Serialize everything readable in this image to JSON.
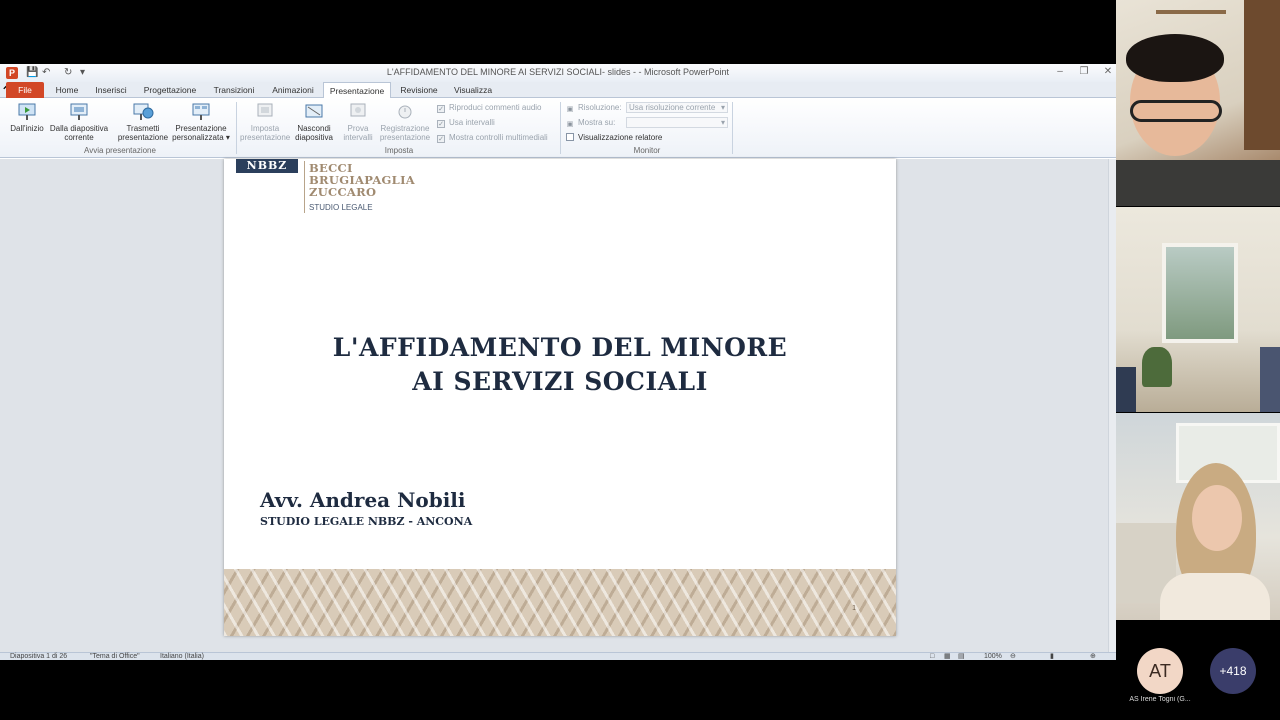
{
  "window": {
    "title": "L'AFFIDAMENTO DEL MINORE AI SERVIZI SOCIALI- slides -  -  Microsoft PowerPoint",
    "app_icon": "P"
  },
  "tabs": [
    {
      "label": "File"
    },
    {
      "label": "Home"
    },
    {
      "label": "Inserisci"
    },
    {
      "label": "Progettazione"
    },
    {
      "label": "Transizioni"
    },
    {
      "label": "Animazioni"
    },
    {
      "label": "Presentazione"
    },
    {
      "label": "Revisione"
    },
    {
      "label": "Visualizza"
    }
  ],
  "ribbon": {
    "avvia": {
      "dallinizio": "Dall'inizio",
      "dalla_l1": "Dalla diapositiva",
      "dalla_l2": "corrente",
      "trasmetti_l1": "Trasmetti",
      "trasmetti_l2": "presentazione",
      "personalizzata_l1": "Presentazione",
      "personalizzata_l2": "personalizzata",
      "label": "Avvia presentazione"
    },
    "imposta": {
      "imposta_l1": "Imposta",
      "imposta_l2": "presentazione",
      "nascondi_l1": "Nascondi",
      "nascondi_l2": "diapositiva",
      "prova_l1": "Prova",
      "prova_l2": "intervalli",
      "registrazione_l1": "Registrazione",
      "registrazione_l2": "presentazione",
      "riproduci": "Riproduci commenti audio",
      "usa_intervalli": "Usa intervalli",
      "mostra_controlli": "Mostra controlli multimediali",
      "label": "Imposta"
    },
    "monitor": {
      "risoluzione_label": "Risoluzione:",
      "risoluzione_value": "Usa risoluzione corrente",
      "mostra_su_label": "Mostra su:",
      "visualizzazione_relatore": "Visualizzazione relatore",
      "label": "Monitor"
    }
  },
  "slide": {
    "logo_mark": "NBBZ",
    "logo_line1": "BECCI",
    "logo_line2": "BRUGIAPAGLIA",
    "logo_line3": "ZUCCARO",
    "logo_sub": "STUDIO LEGALE",
    "title_line1": "L'AFFIDAMENTO DEL MINORE",
    "title_line2": "AI SERVIZI SOCIALI",
    "author": "Avv. Andrea Nobili",
    "firm": "STUDIO LEGALE NBBZ - ANCONA",
    "page_number": "1"
  },
  "status": {
    "slide_info": "Diapositiva 1 di 26",
    "theme": "\"Tema di Office\"",
    "language": "Italiano (Italia)",
    "zoom": "100%"
  },
  "meeting": {
    "avatar_initials": "AT",
    "more_count": "+418",
    "caption": "AS Irene Togni (G..."
  },
  "colors": {
    "file_tab": "#d24726",
    "slide_title": "#1e2b40",
    "logo_gold": "#a08a70",
    "more_badge": "#3a3d6a"
  }
}
